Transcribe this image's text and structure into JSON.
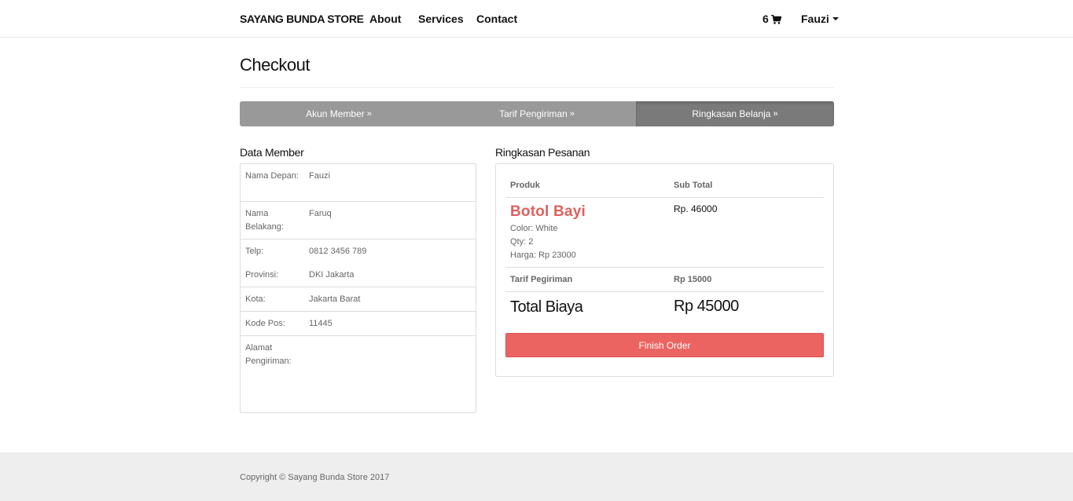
{
  "navbar": {
    "brand": "SAYANG BUNDA STORE",
    "links": [
      "About",
      "Services",
      "Contact"
    ],
    "cart_count": "6",
    "user_name": "Fauzi"
  },
  "page": {
    "title": "Checkout"
  },
  "steps": [
    {
      "label": "Akun Member",
      "active": false
    },
    {
      "label": "Tarif Pengiriman",
      "active": false
    },
    {
      "label": "Ringkasan Belanja",
      "active": true
    }
  ],
  "member": {
    "heading": "Data Member",
    "rows": [
      {
        "label": "Nama Depan:",
        "value": "Fauzi"
      },
      {
        "label": "Nama Belakang:",
        "value": "Faruq"
      },
      {
        "label": "Telp:",
        "value": "0812 3456 789"
      },
      {
        "label": "Provinsi:",
        "value": "DKI Jakarta"
      },
      {
        "label": "Kota:",
        "value": "Jakarta Barat"
      },
      {
        "label": "Kode Pos:",
        "value": "11445"
      },
      {
        "label": "Alamat Pengiriman:",
        "value": ""
      }
    ]
  },
  "order": {
    "heading": "Ringkasan Pesanan",
    "col_product": "Produk",
    "col_subtotal": "Sub Total",
    "product": {
      "name": "Botol Bayi",
      "color": "Color: White",
      "qty": "Qty: 2",
      "price": "Harga: Rp 23000",
      "subtotal": "Rp. 46000"
    },
    "shipping_label": "Tarif Pegiriman",
    "shipping_value": "Rp 15000",
    "total_label": "Total Biaya",
    "total_value": "Rp 45000",
    "finish_button": "Finish Order"
  },
  "footer": {
    "copyright": "Copyright © Sayang Bunda Store 2017"
  },
  "colors": {
    "accent": "#ec6461",
    "product_name": "#e0605f",
    "step_bar": "#999999",
    "step_active": "#7a7a7a",
    "footer_bg": "#eeeeee"
  }
}
